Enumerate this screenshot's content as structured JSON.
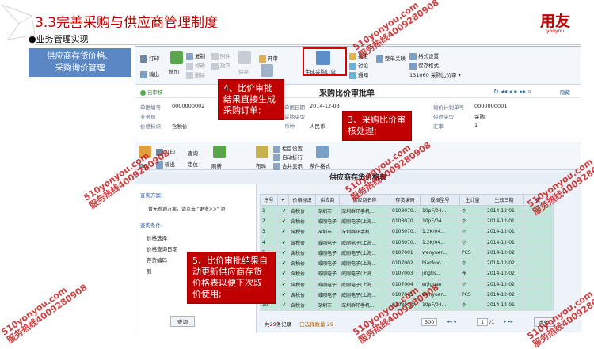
{
  "slide": {
    "title": "3.3完善采购与供应商管理制度",
    "logo": "用友",
    "logo_sub": "yonyou",
    "bullet": "●业务管理实现",
    "side_label_line1": "供应商存货价格、",
    "side_label_line2": "采购询价管理"
  },
  "toolbar": {
    "print": "打印",
    "output": "输出",
    "add": "增加",
    "copy": "复制",
    "modify": "修改",
    "delete": "删除",
    "attach": "附件",
    "abandon": "放弃",
    "save": "保存",
    "open": "开审",
    "audit": "审核",
    "gen_order": "生成采购订单",
    "remind": "指定",
    "discuss": "讨论",
    "notify": "通知",
    "doc_link": "整单关联",
    "format_setting": "格式设置",
    "save_format": "保存格式",
    "format_code": "131060",
    "format_name": "采购比价审"
  },
  "docbar": {
    "status": "已审核",
    "title": "采购比价审批单",
    "hide": "隐藏"
  },
  "form": {
    "doc_no_label": "单据编号",
    "doc_no": "0000000002",
    "date_label": "单据日期",
    "date": "2014-12-03",
    "plan_no_label": "询价计划单号",
    "plan_no": "0000000001",
    "staff_label": "业务员",
    "purchase_type_label": "采购类型",
    "supplier_type_label": "供应类型",
    "supplier_type": "采购",
    "price_label": "价格标识",
    "price": "含税价",
    "currency_label": "币种",
    "currency": "人民币",
    "rate_label": "汇率",
    "rate": "1"
  },
  "toolbar2": {
    "price_adjust": "调价",
    "print": "打印",
    "output": "输出",
    "query": "查询",
    "locate": "定位",
    "refresh": "刷新",
    "layout": "布局",
    "col_setting": "栏目设置",
    "auto_wrap": "自动折行",
    "merge_show": "合并显示",
    "cond_format": "条件格式"
  },
  "grid_title": "供应商存货价格表",
  "leftpane": {
    "scheme_label": "查询方案:",
    "scheme_hint": "暂无查询方案，请点击 \"更多>>\" 添",
    "cond_label": "查询条件:",
    "conds": [
      "价格选择",
      "价格查询日期",
      "存货编码",
      "到"
    ],
    "query_btn": "查询"
  },
  "grid": {
    "headers": [
      "序号",
      "",
      "价格标识",
      "供应商",
      "供应商名称",
      "存货编码",
      "规格型号",
      "主计量",
      "生效日期",
      "失"
    ],
    "rows": [
      [
        "1",
        "✔",
        "含税价",
        "深圳市",
        "深圳群环手机...",
        "0103070...",
        "10pF/04...",
        "个",
        "2014-12-01"
      ],
      [
        "2",
        "✔",
        "含税价",
        "威刚电子",
        "威刚电子(上海...",
        "0103070...",
        "10pF/04...",
        "个",
        "2014-12-01"
      ],
      [
        "3",
        "✔",
        "含税价",
        "深圳市",
        "深圳群环手机...",
        "0103070...",
        "1.2K/04...",
        "个",
        "2014-12-01"
      ],
      [
        "4",
        "✔",
        "含税价",
        "威刚电子",
        "威刚电子(上海...",
        "0103070...",
        "1.2K/04...",
        "个",
        "2014-12-01"
      ],
      [
        "5",
        "✔",
        "含税价",
        "威刚电子",
        "威刚电子(上海...",
        "0107001",
        "wenyuer...",
        "PCS",
        "2014-12-02"
      ],
      [
        "6",
        "✔",
        "含税价",
        "威刚电子",
        "威刚电子(上海...",
        "0107002",
        "biankon...",
        "个",
        "2014-12-02"
      ],
      [
        "7",
        "✔",
        "含税价",
        "威刚电子",
        "威刚电子(上海...",
        "0107003",
        "jingtis...",
        "件",
        "2014-12-02"
      ],
      [
        "8",
        "✔",
        "含税价",
        "威刚电子",
        "威刚电子(上海...",
        "0107004",
        "erjiguan",
        "个",
        "2014-12-02"
      ],
      [
        "9",
        "✔",
        "含税价",
        "威刚电子",
        "威刚电子(上海...",
        "0107001",
        "wenyuer...",
        "PCS",
        "2014-12-02"
      ],
      [
        "10",
        "✔",
        "含税价",
        "深圳市",
        "深圳群环手机...",
        "0103070...",
        "10pF/04...",
        "个",
        "2014-12-01"
      ]
    ]
  },
  "pager": {
    "total_prefix": "共",
    "total": "29",
    "total_suffix": "条记录",
    "selected": "已选择数量:29",
    "page_size": "500",
    "page": "1",
    "of": "/1",
    "jump": "跳转"
  },
  "callouts": {
    "c4": "4、比价审批结果直接生成采购订单;",
    "c3": "3、采购比价审核处理;",
    "c5": "5、比价审批结果自动更新供应商存货价格表以便下次取价使用;"
  },
  "watermark": {
    "line1": "510yonyou.com",
    "line2": "服务热线4009280908"
  },
  "colors": {
    "accent": "#c00000",
    "side_label": "#5b88c4",
    "selected_row": "#bfe6d8"
  }
}
